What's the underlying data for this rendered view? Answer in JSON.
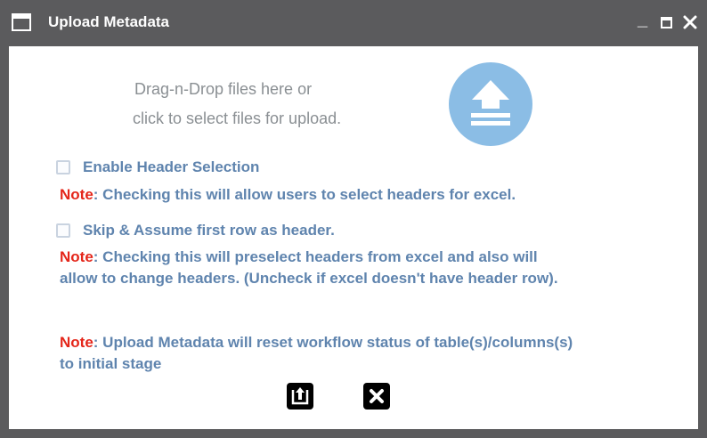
{
  "window": {
    "title": "Upload Metadata",
    "controls": {
      "minimize": "_",
      "maximize_icon": "maximize-icon",
      "close_icon": "close-icon"
    }
  },
  "dropzone": {
    "line1": "Drag-n-Drop files here or",
    "line2": "click to select files for upload.",
    "icon": "upload-icon",
    "icon_color": "#8bbde5"
  },
  "options": {
    "enable_header_selection": {
      "label": "Enable Header Selection",
      "checked": false,
      "note_prefix": "Note",
      "note_text": ": Checking this will allow users to select headers for excel."
    },
    "skip_first_row": {
      "label": "Skip & Assume first row as header.",
      "checked": false,
      "note_prefix": "Note",
      "note_text_line1": ": Checking this will preselect headers from excel and also will",
      "note_text_line2": "allow to change headers. (Uncheck if excel doesn't have header row)."
    }
  },
  "footer_note": {
    "prefix": "Note",
    "line1": ": Upload Metadata will reset workflow status of table(s)/columns(s)",
    "line2": "to initial stage"
  },
  "actions": [
    {
      "name": "upload",
      "icon": "upload-icon"
    },
    {
      "name": "cancel",
      "icon": "close-icon"
    }
  ],
  "colors": {
    "titlebar": "#5b5b5d",
    "label_blue": "#5f84ae",
    "note_red": "#e4261a",
    "hint_gray": "#8a8f93"
  }
}
